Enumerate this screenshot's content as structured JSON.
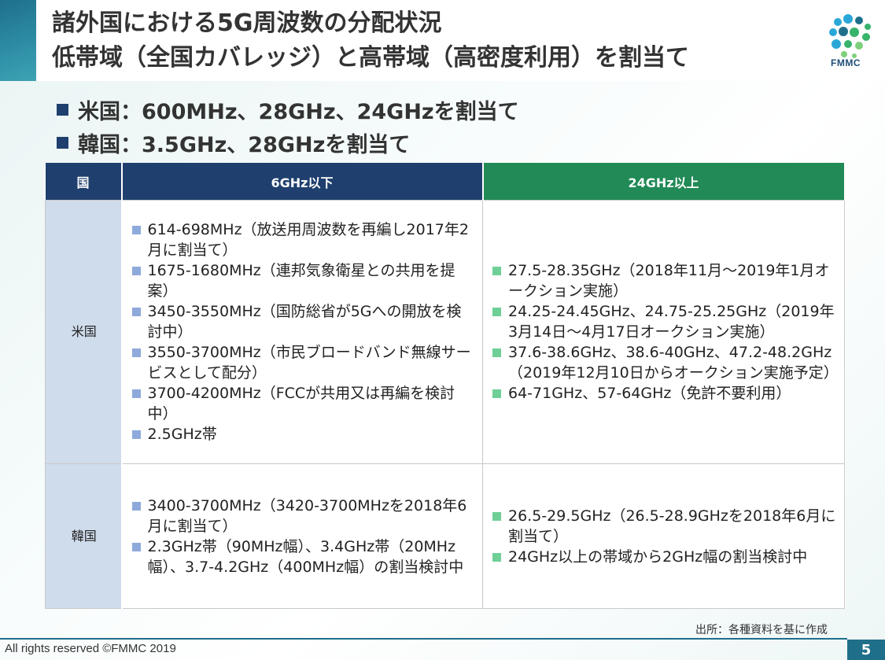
{
  "title": {
    "line1": "諸外国における5G周波数の分配状況",
    "line2": "低帯域（全国カバレッジ）と高帯域（高密度利用）を割当て"
  },
  "logo": {
    "text": "FMMC",
    "icon": "fmmc-dot-logo-icon",
    "colors": [
      "#2aa7d9",
      "#1f6f8b",
      "#37b36b",
      "#7ed07a"
    ]
  },
  "bullets": [
    "米国：600MHz、28GHz、24GHzを割当て",
    "韓国：3.5GHz、28GHzを割当て"
  ],
  "table": {
    "headers": [
      "国",
      "6GHz以下",
      "24GHz以上"
    ],
    "header_colors": {
      "low": "#1f3f6e",
      "high": "#218a56"
    },
    "rows": [
      {
        "country": "米国",
        "low": [
          "614-698MHz（放送用周波数を再編し2017年2月に割当て）",
          "1675-1680MHz（連邦気象衛星との共用を提案）",
          "3450-3550MHz（国防総省が5Gへの開放を検討中）",
          "3550-3700MHz（市民ブロードバンド無線サービスとして配分）",
          "3700-4200MHz（FCCが共用又は再編を検討中）",
          "2.5GHz帯"
        ],
        "high": [
          "27.5-28.35GHz（2018年11月～2019年1月オークション実施）",
          "24.25-24.45GHz、24.75-25.25GHz（2019年3月14日～4月17日オークション実施）",
          "37.6-38.6GHz、38.6-40GHz、47.2-48.2GHz（2019年12月10日からオークション実施予定）",
          "64-71GHz、57-64GHz（免許不要利用）"
        ]
      },
      {
        "country": "韓国",
        "low": [
          "3400-3700MHz（3420-3700MHzを2018年6月に割当て）",
          "2.3GHz帯（90MHz幅）、3.4GHz帯（20MHz幅）、3.7-4.2GHz（400MHz幅）の割当検討中"
        ],
        "high": [
          "26.5-29.5GHz（26.5-28.9GHzを2018年6月に割当て）",
          "24GHz以上の帯域から2GHz幅の割当検討中"
        ]
      }
    ]
  },
  "source": "出所：各種資料を基に作成",
  "footer": {
    "copyright": "All rights reserved ©FMMC 2019",
    "page": "5"
  }
}
